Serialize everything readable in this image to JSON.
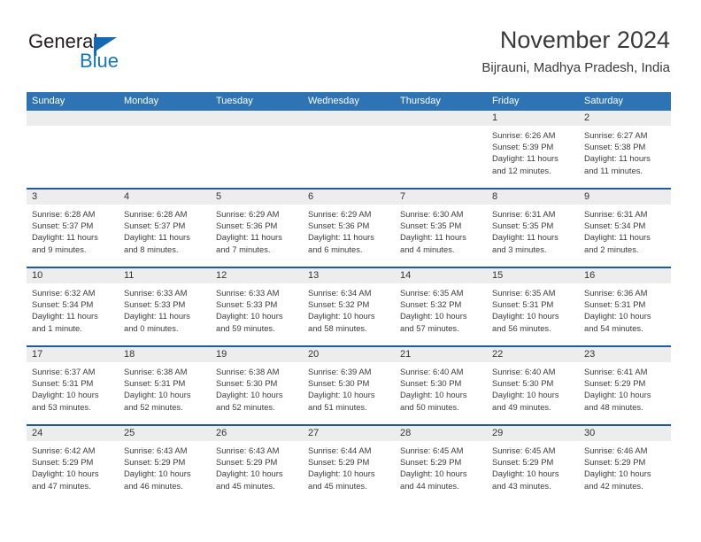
{
  "logo": {
    "word_one": "General",
    "word_two": "Blue",
    "flag_icon": "blue-flag-icon",
    "brand_blue": "#1476bc"
  },
  "header": {
    "title": "November 2024",
    "subtitle": "Bijrauni, Madhya Pradesh, India"
  },
  "theme": {
    "header_blue": "#2e74b5",
    "row_border": "#1f5c9e",
    "daynum_band": "#ededed"
  },
  "calendar": {
    "weekdays": [
      "Sunday",
      "Monday",
      "Tuesday",
      "Wednesday",
      "Thursday",
      "Friday",
      "Saturday"
    ],
    "weeks": [
      [
        {
          "day": "",
          "lines": []
        },
        {
          "day": "",
          "lines": []
        },
        {
          "day": "",
          "lines": []
        },
        {
          "day": "",
          "lines": []
        },
        {
          "day": "",
          "lines": []
        },
        {
          "day": "1",
          "lines": [
            "Sunrise: 6:26 AM",
            "Sunset: 5:39 PM",
            "Daylight: 11 hours",
            "and 12 minutes."
          ]
        },
        {
          "day": "2",
          "lines": [
            "Sunrise: 6:27 AM",
            "Sunset: 5:38 PM",
            "Daylight: 11 hours",
            "and 11 minutes."
          ]
        }
      ],
      [
        {
          "day": "3",
          "lines": [
            "Sunrise: 6:28 AM",
            "Sunset: 5:37 PM",
            "Daylight: 11 hours",
            "and 9 minutes."
          ]
        },
        {
          "day": "4",
          "lines": [
            "Sunrise: 6:28 AM",
            "Sunset: 5:37 PM",
            "Daylight: 11 hours",
            "and 8 minutes."
          ]
        },
        {
          "day": "5",
          "lines": [
            "Sunrise: 6:29 AM",
            "Sunset: 5:36 PM",
            "Daylight: 11 hours",
            "and 7 minutes."
          ]
        },
        {
          "day": "6",
          "lines": [
            "Sunrise: 6:29 AM",
            "Sunset: 5:36 PM",
            "Daylight: 11 hours",
            "and 6 minutes."
          ]
        },
        {
          "day": "7",
          "lines": [
            "Sunrise: 6:30 AM",
            "Sunset: 5:35 PM",
            "Daylight: 11 hours",
            "and 4 minutes."
          ]
        },
        {
          "day": "8",
          "lines": [
            "Sunrise: 6:31 AM",
            "Sunset: 5:35 PM",
            "Daylight: 11 hours",
            "and 3 minutes."
          ]
        },
        {
          "day": "9",
          "lines": [
            "Sunrise: 6:31 AM",
            "Sunset: 5:34 PM",
            "Daylight: 11 hours",
            "and 2 minutes."
          ]
        }
      ],
      [
        {
          "day": "10",
          "lines": [
            "Sunrise: 6:32 AM",
            "Sunset: 5:34 PM",
            "Daylight: 11 hours",
            "and 1 minute."
          ]
        },
        {
          "day": "11",
          "lines": [
            "Sunrise: 6:33 AM",
            "Sunset: 5:33 PM",
            "Daylight: 11 hours",
            "and 0 minutes."
          ]
        },
        {
          "day": "12",
          "lines": [
            "Sunrise: 6:33 AM",
            "Sunset: 5:33 PM",
            "Daylight: 10 hours",
            "and 59 minutes."
          ]
        },
        {
          "day": "13",
          "lines": [
            "Sunrise: 6:34 AM",
            "Sunset: 5:32 PM",
            "Daylight: 10 hours",
            "and 58 minutes."
          ]
        },
        {
          "day": "14",
          "lines": [
            "Sunrise: 6:35 AM",
            "Sunset: 5:32 PM",
            "Daylight: 10 hours",
            "and 57 minutes."
          ]
        },
        {
          "day": "15",
          "lines": [
            "Sunrise: 6:35 AM",
            "Sunset: 5:31 PM",
            "Daylight: 10 hours",
            "and 56 minutes."
          ]
        },
        {
          "day": "16",
          "lines": [
            "Sunrise: 6:36 AM",
            "Sunset: 5:31 PM",
            "Daylight: 10 hours",
            "and 54 minutes."
          ]
        }
      ],
      [
        {
          "day": "17",
          "lines": [
            "Sunrise: 6:37 AM",
            "Sunset: 5:31 PM",
            "Daylight: 10 hours",
            "and 53 minutes."
          ]
        },
        {
          "day": "18",
          "lines": [
            "Sunrise: 6:38 AM",
            "Sunset: 5:31 PM",
            "Daylight: 10 hours",
            "and 52 minutes."
          ]
        },
        {
          "day": "19",
          "lines": [
            "Sunrise: 6:38 AM",
            "Sunset: 5:30 PM",
            "Daylight: 10 hours",
            "and 52 minutes."
          ]
        },
        {
          "day": "20",
          "lines": [
            "Sunrise: 6:39 AM",
            "Sunset: 5:30 PM",
            "Daylight: 10 hours",
            "and 51 minutes."
          ]
        },
        {
          "day": "21",
          "lines": [
            "Sunrise: 6:40 AM",
            "Sunset: 5:30 PM",
            "Daylight: 10 hours",
            "and 50 minutes."
          ]
        },
        {
          "day": "22",
          "lines": [
            "Sunrise: 6:40 AM",
            "Sunset: 5:30 PM",
            "Daylight: 10 hours",
            "and 49 minutes."
          ]
        },
        {
          "day": "23",
          "lines": [
            "Sunrise: 6:41 AM",
            "Sunset: 5:29 PM",
            "Daylight: 10 hours",
            "and 48 minutes."
          ]
        }
      ],
      [
        {
          "day": "24",
          "lines": [
            "Sunrise: 6:42 AM",
            "Sunset: 5:29 PM",
            "Daylight: 10 hours",
            "and 47 minutes."
          ]
        },
        {
          "day": "25",
          "lines": [
            "Sunrise: 6:43 AM",
            "Sunset: 5:29 PM",
            "Daylight: 10 hours",
            "and 46 minutes."
          ]
        },
        {
          "day": "26",
          "lines": [
            "Sunrise: 6:43 AM",
            "Sunset: 5:29 PM",
            "Daylight: 10 hours",
            "and 45 minutes."
          ]
        },
        {
          "day": "27",
          "lines": [
            "Sunrise: 6:44 AM",
            "Sunset: 5:29 PM",
            "Daylight: 10 hours",
            "and 45 minutes."
          ]
        },
        {
          "day": "28",
          "lines": [
            "Sunrise: 6:45 AM",
            "Sunset: 5:29 PM",
            "Daylight: 10 hours",
            "and 44 minutes."
          ]
        },
        {
          "day": "29",
          "lines": [
            "Sunrise: 6:45 AM",
            "Sunset: 5:29 PM",
            "Daylight: 10 hours",
            "and 43 minutes."
          ]
        },
        {
          "day": "30",
          "lines": [
            "Sunrise: 6:46 AM",
            "Sunset: 5:29 PM",
            "Daylight: 10 hours",
            "and 42 minutes."
          ]
        }
      ]
    ]
  }
}
